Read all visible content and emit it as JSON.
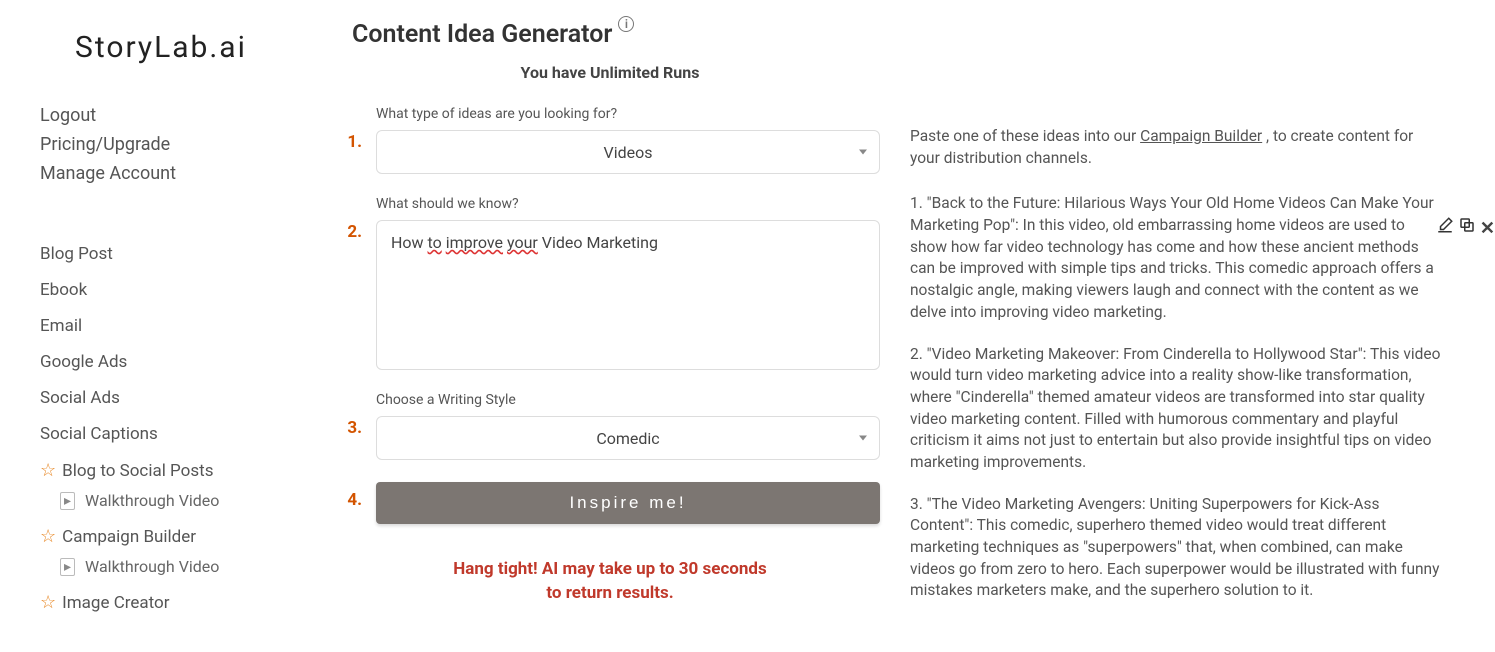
{
  "logo": "StoryLab.ai",
  "account": {
    "logout": "Logout",
    "pricing": "Pricing/Upgrade",
    "manage": "Manage Account"
  },
  "nav": {
    "blog_post": "Blog Post",
    "ebook": "Ebook",
    "email": "Email",
    "google_ads": "Google Ads",
    "social_ads": "Social Ads",
    "social_captions": "Social Captions",
    "blog_to_social": "Blog to Social Posts",
    "walkthrough_video": "Walkthrough Video",
    "campaign_builder": "Campaign Builder",
    "image_creator": "Image Creator"
  },
  "page": {
    "title": "Content Idea Generator",
    "runs_line": "You have Unlimited Runs"
  },
  "form": {
    "step1_label": "What type of ideas are you looking for?",
    "step1_value": "Videos",
    "step2_label": "What should we know?",
    "step2_value": "How to improve your Video Marketing",
    "step3_label": "Choose a Writing Style",
    "step3_value": "Comedic",
    "submit_label": "Inspire me!",
    "steps": {
      "s1": "1.",
      "s2": "2.",
      "s3": "3.",
      "s4": "4."
    }
  },
  "wait_msg_l1": "Hang tight! AI may take up to 30 seconds",
  "wait_msg_l2": "to return results.",
  "results": {
    "intro_pre": "Paste one of these ideas into our ",
    "intro_link": "Campaign Builder",
    "intro_post": " , to create content for your distribution channels.",
    "idea1": "1. \"Back to the Future: Hilarious Ways Your Old Home Videos Can Make Your Marketing Pop\": In this video, old embarrassing home videos are used to show how far video technology has come and how these ancient methods can be improved with simple tips and tricks. This comedic approach offers a nostalgic angle, making viewers laugh and connect with the content as we delve into improving video marketing.",
    "idea2": "2. \"Video Marketing Makeover: From Cinderella to Hollywood Star\": This video would turn video marketing advice into a reality show-like transformation, where \"Cinderella\" themed amateur videos are transformed into star quality video marketing content. Filled with humorous commentary and playful criticism it aims not just to entertain but also provide insightful tips on video marketing improvements.",
    "idea3": "3. \"The Video Marketing Avengers: Uniting Superpowers for Kick-Ass Content\": This comedic, superhero themed video would treat different marketing techniques as \"superpowers\" that, when combined, can make videos go from zero to hero. Each superpower would be illustrated with funny mistakes marketers make, and the superhero solution to it."
  }
}
